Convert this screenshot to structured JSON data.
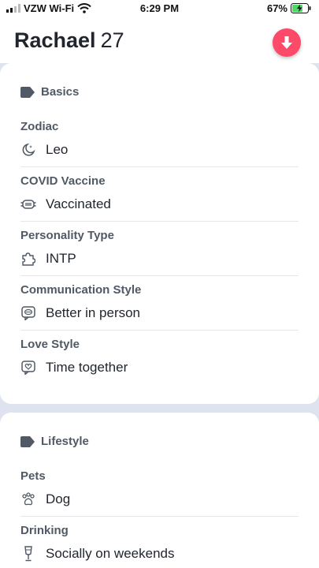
{
  "status_bar": {
    "carrier": "VZW Wi-Fi",
    "time": "6:29 PM",
    "battery": "67%"
  },
  "header": {
    "name": "Rachael",
    "age": "27"
  },
  "basics": {
    "title": "Basics",
    "fields": [
      {
        "label": "Zodiac",
        "value": "Leo",
        "icon": "moon-icon"
      },
      {
        "label": "COVID Vaccine",
        "value": "Vaccinated",
        "icon": "mask-icon"
      },
      {
        "label": "Personality Type",
        "value": "INTP",
        "icon": "puzzle-icon"
      },
      {
        "label": "Communication Style",
        "value": "Better in person",
        "icon": "chat-icon"
      },
      {
        "label": "Love Style",
        "value": "Time together",
        "icon": "heart-chat-icon"
      }
    ]
  },
  "lifestyle": {
    "title": "Lifestyle",
    "fields": [
      {
        "label": "Pets",
        "value": "Dog",
        "icon": "paw-icon"
      },
      {
        "label": "Drinking",
        "value": "Socially on weekends",
        "icon": "glass-icon"
      }
    ]
  },
  "colors": {
    "accent": "#fd4a68",
    "label": "#505965",
    "text": "#21262e",
    "backdrop": "#dfe2ef"
  }
}
